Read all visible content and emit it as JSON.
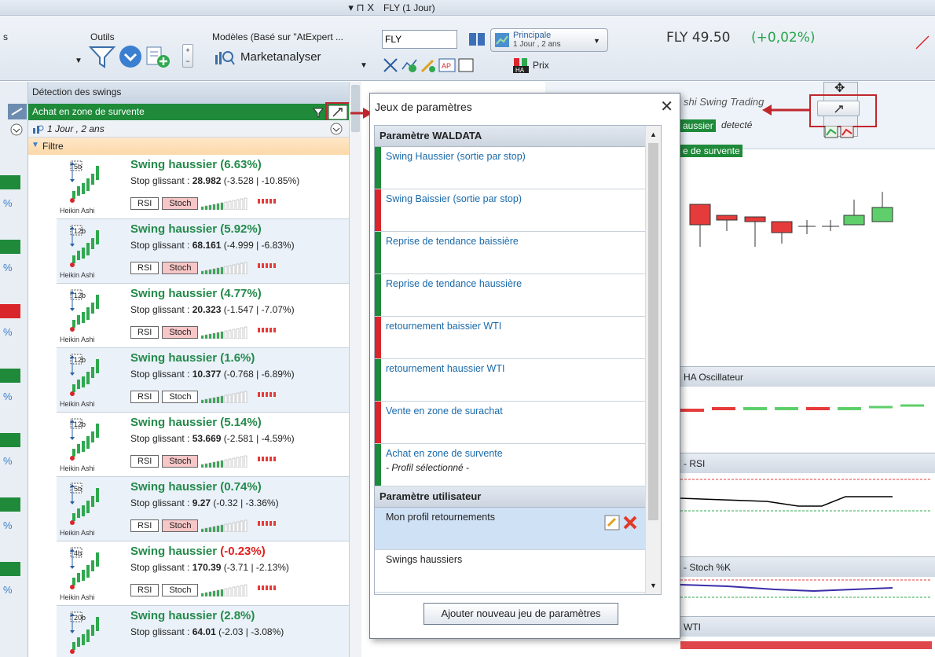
{
  "left_toolbar": {
    "pane_controls": "▾ ⊓ X",
    "tab_s": "s",
    "group_outils": "Outils",
    "group_modeles": "Modèles (Basé sur \"AtExpert ...",
    "marketanalyser": "Marketanalyser"
  },
  "right_toolbar": {
    "title": "FLY (1 Jour)",
    "symbol_value": "FLY",
    "principale_label": "Principale",
    "principale_sub": "1 Jour , 2 ans",
    "quote_symbol": "FLY 49.50",
    "quote_change": "(+0,02%)",
    "prix_label": "Prix"
  },
  "list": {
    "title": "Détection des swings",
    "strategy": "Achat en zone de survente",
    "period": "1 Jour , 2 ans",
    "filter": "Filtre"
  },
  "rows": [
    {
      "period": "5b",
      "title": "Swing haussier (6.63%)",
      "stop_label": "Stop glissant : ",
      "stop_value": "28.982",
      "stop_detail": " (-3.528 | -10.85%)",
      "ha": "Heikin Ashi",
      "rsi": "RSI",
      "stoch": "Stoch",
      "stoch_red": true,
      "side": "%",
      "side_red": false
    },
    {
      "period": "12b",
      "title": "Swing haussier (5.92%)",
      "stop_label": "Stop glissant : ",
      "stop_value": "68.161",
      "stop_detail": " (-4.999 | -6.83%)",
      "ha": "Heikin Ashi",
      "rsi": "RSI",
      "stoch": "Stoch",
      "stoch_red": true,
      "side": "%",
      "side_red": false
    },
    {
      "period": "12b",
      "title": "Swing haussier (4.77%)",
      "stop_label": "Stop glissant : ",
      "stop_value": "20.323",
      "stop_detail": " (-1.547 | -7.07%)",
      "ha": "Heikin Ashi",
      "rsi": "RSI",
      "stoch": "Stoch",
      "stoch_red": true,
      "side": "%",
      "side_red": true
    },
    {
      "period": "12b",
      "title": "Swing haussier (1.6%)",
      "stop_label": "Stop glissant : ",
      "stop_value": "10.377",
      "stop_detail": " (-0.768 | -6.89%)",
      "ha": "Heikin Ashi",
      "rsi": "RSI",
      "stoch": "Stoch",
      "stoch_red": false,
      "side": "%",
      "side_red": false
    },
    {
      "period": "12b",
      "title": "Swing haussier (5.14%)",
      "stop_label": "Stop glissant : ",
      "stop_value": "53.669",
      "stop_detail": " (-2.581 | -4.59%)",
      "ha": "Heikin Ashi",
      "rsi": "RSI",
      "stoch": "Stoch",
      "stoch_red": true,
      "side": "%",
      "side_red": false
    },
    {
      "period": "5b",
      "title": "Swing haussier (0.74%)",
      "stop_label": "Stop glissant : ",
      "stop_value": "9.27",
      "stop_detail": " (-0.32 | -3.36%)",
      "ha": "Heikin Ashi",
      "rsi": "RSI",
      "stoch": "Stoch",
      "stoch_red": true,
      "side": "%",
      "side_red": false
    },
    {
      "period": "4b",
      "title_prefix": "Swing haussier ",
      "title_neg": "(-0.23%)",
      "stop_label": "Stop glissant : ",
      "stop_value": "170.39",
      "stop_detail": " (-3.71 | -2.13%)",
      "ha": "Heikin Ashi",
      "rsi": "RSI",
      "stoch": "Stoch",
      "stoch_red": false,
      "side": "%",
      "side_red": false
    },
    {
      "period": "20b",
      "title": "Swing haussier (2.8%)",
      "stop_label": "Stop glissant : ",
      "stop_value": "64.01",
      "stop_detail": " (-2.03 | -3.08%)",
      "ha": "",
      "rsi": "",
      "stoch": "",
      "stoch_red": false,
      "side": "",
      "side_red": false
    }
  ],
  "chart": {
    "strategy_title": "shi Swing Trading",
    "detected_tag": "aussier",
    "detected_text": "detecté",
    "zone_tag": "e de survente",
    "panel1": "HA Oscillateur",
    "panel2": "- RSI",
    "panel3": "- Stoch %K",
    "panel4": "WTI"
  },
  "dialog": {
    "title": "Jeux de paramètres",
    "close": "✕",
    "group_waldata": "Paramètre WALDATA",
    "group_user": "Paramètre utilisateur",
    "items": [
      {
        "label": "Swing Haussier (sortie par stop)",
        "color": "#1f8a3a"
      },
      {
        "label": "Swing Baissier (sortie par stop)",
        "color": "#d9262b"
      },
      {
        "label": "Reprise de tendance baissière",
        "color": "#1f8a3a"
      },
      {
        "label": "Reprise de tendance haussière",
        "color": "#1f8a3a"
      },
      {
        "label": "retournement baissier WTI",
        "color": "#d9262b"
      },
      {
        "label": "retournement haussier WTI",
        "color": "#1f8a3a"
      },
      {
        "label": "Vente en zone de surachat",
        "color": "#d9262b"
      },
      {
        "label": "Achat en zone de survente",
        "color": "#1f8a3a",
        "sub": "- Profil sélectionné -"
      }
    ],
    "user_items": [
      {
        "label": "Mon profil retournements"
      },
      {
        "label": "Swings haussiers"
      }
    ],
    "add_button": "Ajouter nouveau jeu de paramètres"
  },
  "colors": {
    "accent_green": "#1f8a3a",
    "accent_red": "#d9262b",
    "highlight_box": "#c0272d"
  }
}
